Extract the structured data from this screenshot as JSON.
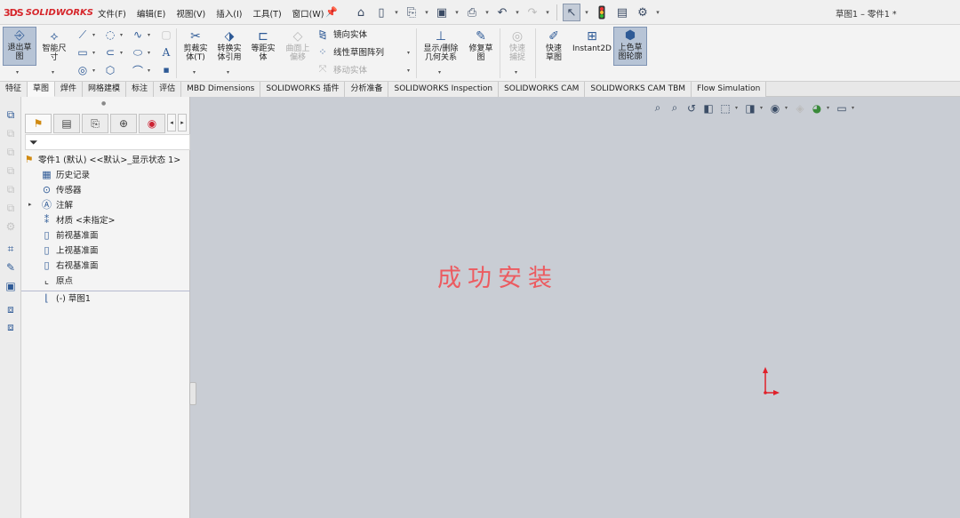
{
  "app": {
    "logo_prefix": "3DS",
    "logo_text": "SOLIDWORKS",
    "doc_title": "草图1 – 零件1 *"
  },
  "menu": [
    "文件(F)",
    "编辑(E)",
    "视图(V)",
    "插入(I)",
    "工具(T)",
    "窗口(W)"
  ],
  "ribbon": {
    "exit_sketch": "退出草图",
    "smart_dimension": "智能尺寸",
    "trim": "剪裁实体(T)",
    "convert": "转换实体引用",
    "offset": "等距实体",
    "surface_offset": "曲面上偏移",
    "mirror": "镜向实体",
    "linear_pattern": "线性草图阵列",
    "move": "移动实体",
    "show_relations": "显示/删除几何关系",
    "repair": "修复草图",
    "quick_snap": "快速捕捉",
    "rapid_sketch": "快速草图",
    "instant2d": "Instant2D",
    "shaded_sketch": "上色草图轮廓"
  },
  "tabs": [
    "特征",
    "草图",
    "焊件",
    "网格建模",
    "标注",
    "评估",
    "MBD Dimensions",
    "SOLIDWORKS 插件",
    "分析准备",
    "SOLIDWORKS Inspection",
    "SOLIDWORKS CAM",
    "SOLIDWORKS CAM TBM",
    "Flow Simulation"
  ],
  "active_tab": "草图",
  "tree": {
    "root": "零件1 (默认) <<默认>_显示状态 1>",
    "items": [
      "历史记录",
      "传感器",
      "注解",
      "材质 <未指定>",
      "前视基准面",
      "上视基准面",
      "右视基准面",
      "原点",
      "(-) 草图1"
    ]
  },
  "viewport": {
    "message": "成功安装"
  },
  "colors": {
    "brand": "#d6262b",
    "message": "#ec5b60",
    "origin": "#e0202a",
    "viewport_bg": "#c9cdd4"
  }
}
